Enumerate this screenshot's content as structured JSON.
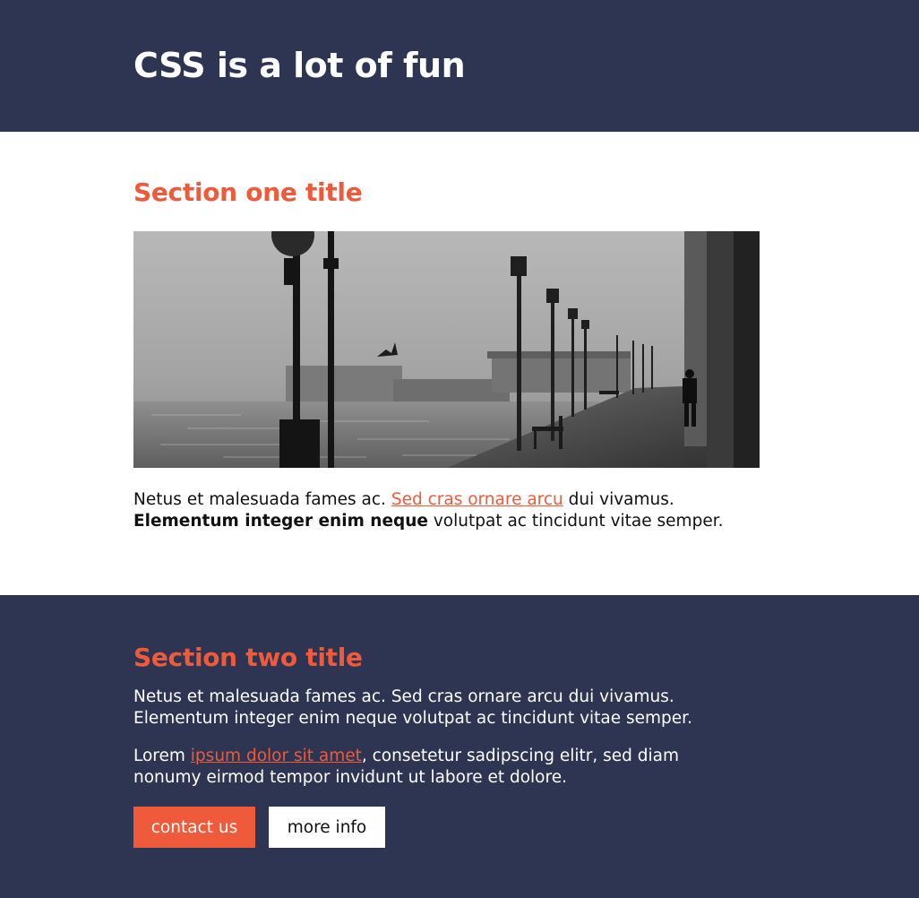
{
  "header": {
    "title": "CSS is a lot of fun"
  },
  "section_one": {
    "title": "Section one title",
    "para": {
      "t1": "Netus et malesuada fames ac. ",
      "link": "Sed cras ornare arcu",
      "t2": " dui vivamus. ",
      "bold": "Elementum integer enim neque",
      "t3": " volutpat ac tincidunt vitae semper."
    }
  },
  "section_two": {
    "title": "Section two title",
    "para1": "Netus et malesuada fames ac. Sed cras ornare arcu dui vivamus. Elementum integer enim neque volutpat ac tincidunt vitae semper.",
    "para2": {
      "t1": "Lorem ",
      "link": "ipsum dolor sit amet",
      "t2": ", consetetur sadipscing elitr, sed diam nonumy eirmod tempor invidunt ut labore et dolore."
    },
    "buttons": {
      "primary": "contact us",
      "secondary": "more info"
    }
  },
  "colors": {
    "navy": "#2e3552",
    "accent": "#ef5a3b",
    "white": "#ffffff"
  }
}
